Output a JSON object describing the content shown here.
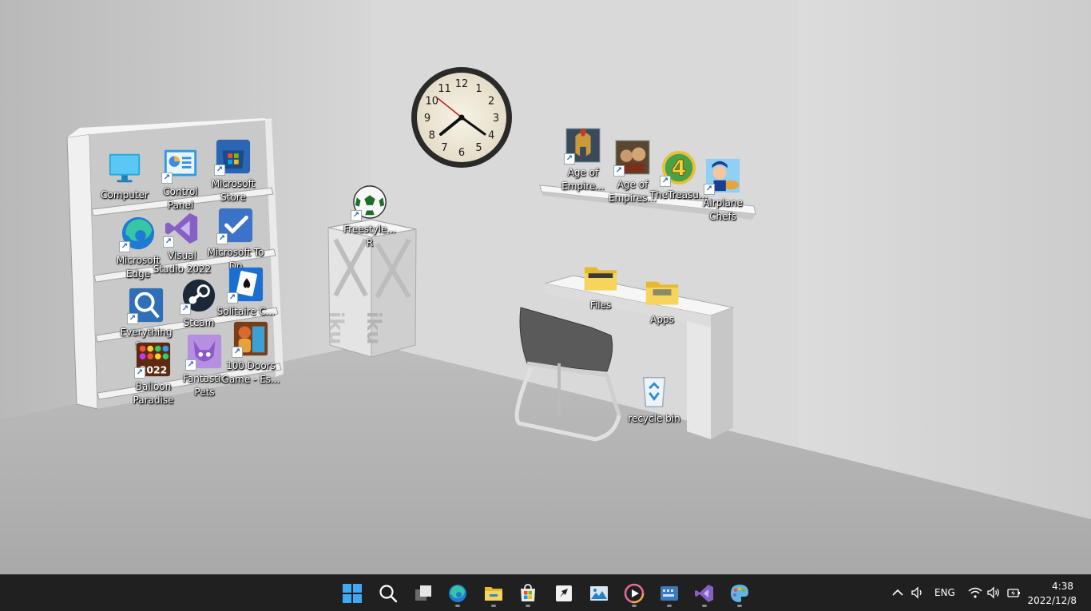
{
  "desktop": {
    "icons": [
      {
        "label": "Computer"
      },
      {
        "label": "Control Panel"
      },
      {
        "label": "Microsoft Store"
      },
      {
        "label": "Microsoft Edge"
      },
      {
        "label": "Visual Studio 2022"
      },
      {
        "label": "Microsoft To Do"
      },
      {
        "label": "Everything Se..."
      },
      {
        "label": "Steam"
      },
      {
        "label": "Solitaire C..."
      },
      {
        "label": "Balloon Paradise"
      },
      {
        "label": "Fantastic Pets"
      },
      {
        "label": "100 Doors Game - Es..."
      },
      {
        "label": "Freestyle... R"
      },
      {
        "label": "Age of Empire..."
      },
      {
        "label": "Age of Empires..."
      },
      {
        "label": "TheTreasu..."
      },
      {
        "label": "Airplane Chefs"
      },
      {
        "label": "Files"
      },
      {
        "label": "Apps"
      },
      {
        "label": "recycle bin"
      }
    ],
    "clock_numerals": [
      "12",
      "1",
      "2",
      "3",
      "4",
      "5",
      "6",
      "7",
      "8",
      "9",
      "10",
      "11"
    ]
  },
  "taskbar": {
    "apps": [
      {
        "icon": "start-icon"
      },
      {
        "icon": "search-icon"
      },
      {
        "icon": "task-view-icon"
      },
      {
        "icon": "edge-icon"
      },
      {
        "icon": "file-explorer-icon"
      },
      {
        "icon": "microsoft-store-icon"
      },
      {
        "icon": "launcher-icon"
      },
      {
        "icon": "photos-icon"
      },
      {
        "icon": "media-player-icon"
      },
      {
        "icon": "keyboard-app-icon"
      },
      {
        "icon": "visual-studio-icon"
      },
      {
        "icon": "paint-icon"
      }
    ],
    "tray": {
      "language": "ENG",
      "time": "4:38",
      "date": "2022/12/8"
    }
  }
}
